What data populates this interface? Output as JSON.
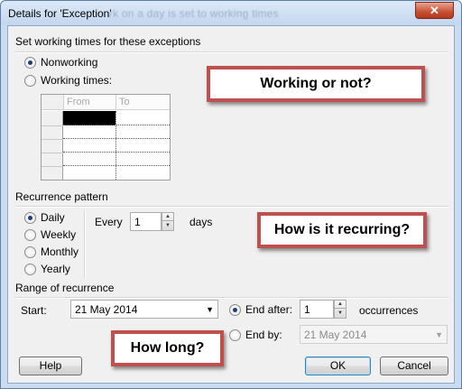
{
  "window": {
    "title": "Details for 'Exception'",
    "title_ghost": "rk on a day is set to working times",
    "close_glyph": "✕"
  },
  "working_times": {
    "group_label": "Set working times for these exceptions",
    "nonworking_label": "Nonworking",
    "working_label": "Working times:",
    "selected": "nonworking",
    "grid": {
      "columns": [
        "From",
        "To"
      ],
      "rows": 5
    }
  },
  "recurrence": {
    "group_label": "Recurrence pattern",
    "options": [
      "Daily",
      "Weekly",
      "Monthly",
      "Yearly"
    ],
    "selected": "Daily",
    "every_label": "Every",
    "every_value": "1",
    "unit_label": "days"
  },
  "range": {
    "group_label": "Range of recurrence",
    "start_label": "Start:",
    "start_value": "21 May 2014",
    "end_after_label": "End after:",
    "end_after_value": "1",
    "occurrences_label": "occurrences",
    "end_by_label": "End by:",
    "end_by_value": "21 May 2014"
  },
  "buttons": {
    "help": "Help",
    "ok": "OK",
    "cancel": "Cancel"
  },
  "callouts": {
    "working": "Working or not?",
    "recurring": "How is it recurring?",
    "how_long": "How long?"
  },
  "colors": {
    "callout_border": "#c0504d",
    "title_bar": "#c3d6ee",
    "close_button": "#c75033"
  }
}
